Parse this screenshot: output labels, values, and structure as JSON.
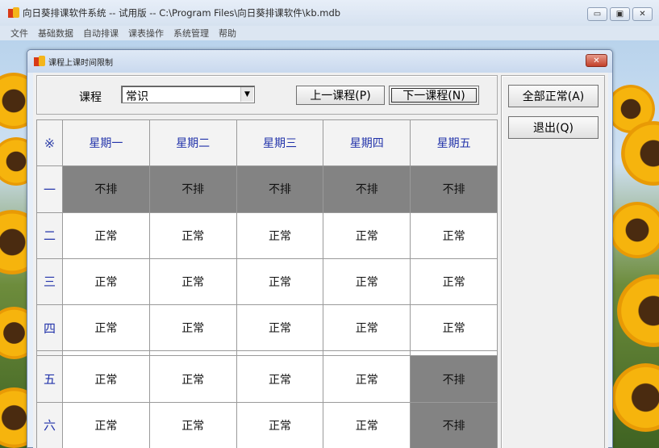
{
  "main_window": {
    "title": "向日葵排课软件系统 -- 试用版 -- C:\\Program Files\\向日葵排课软件\\kb.mdb",
    "menu": [
      "文件",
      "基础数据",
      "自动排课",
      "课表操作",
      "系统管理",
      "帮助"
    ]
  },
  "dialog": {
    "title": "课程上课时间限制",
    "course_label": "课程",
    "course_value": "常识",
    "prev_button": "上一课程(P)",
    "next_button": "下一课程(N)",
    "all_normal_button": "全部正常(A)",
    "exit_button": "退出(Q)",
    "grid": {
      "corner": "※",
      "columns": [
        "星期一",
        "星期二",
        "星期三",
        "星期四",
        "星期五"
      ],
      "rows": [
        {
          "label": "一",
          "cells": [
            "不排",
            "不排",
            "不排",
            "不排",
            "不排"
          ]
        },
        {
          "label": "二",
          "cells": [
            "正常",
            "正常",
            "正常",
            "正常",
            "正常"
          ]
        },
        {
          "label": "三",
          "cells": [
            "正常",
            "正常",
            "正常",
            "正常",
            "正常"
          ]
        },
        {
          "label": "四",
          "cells": [
            "正常",
            "正常",
            "正常",
            "正常",
            "正常"
          ]
        },
        {
          "label": "五",
          "cells": [
            "正常",
            "正常",
            "正常",
            "正常",
            "不排"
          ]
        },
        {
          "label": "六",
          "cells": [
            "正常",
            "正常",
            "正常",
            "正常",
            "不排"
          ]
        }
      ]
    }
  },
  "colors": {
    "off_cell": "#838383",
    "normal_cell": "#ffffff",
    "header_text": "#2233aa"
  }
}
